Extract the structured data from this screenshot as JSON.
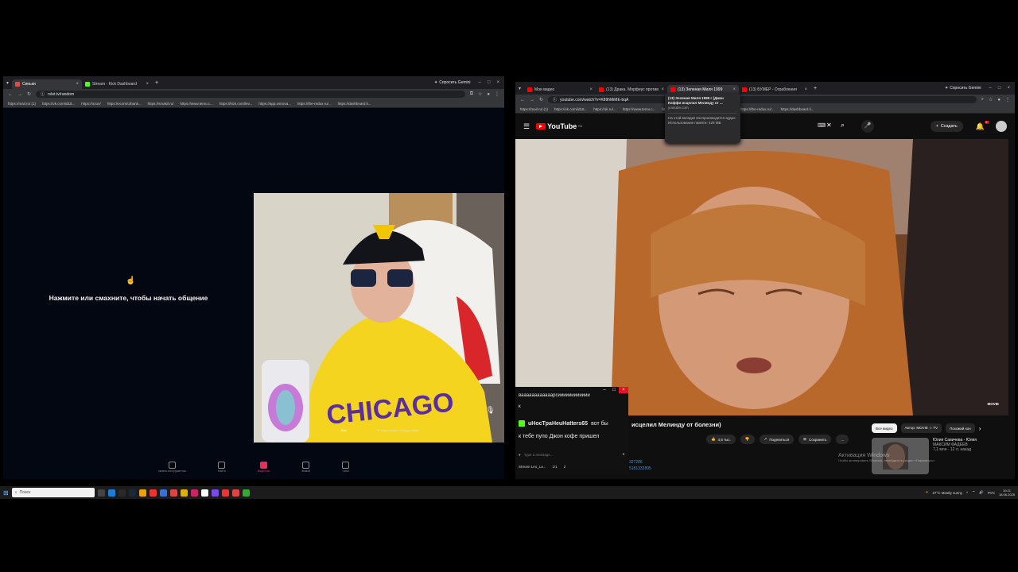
{
  "left_browser": {
    "tabs": [
      {
        "label": "Синьки",
        "color": "#e34b4b",
        "active": true
      },
      {
        "label": "Stream - Kick Dashboard",
        "color": "#53fc18",
        "active": false
      }
    ],
    "new_tab": "+",
    "gemini_label": "Спросить Gemini",
    "url": "rvlet.tv/random",
    "bookmarks": [
      "https://mail.ru/ (1)",
      "https://vk.com/id18...",
      "https://ozon/",
      "https://vcom/u/bank...",
      "https://smakil.ru/",
      "https://www.temu.c...",
      "https://kick.com/lev...",
      "https://app.osnova...",
      "https://the-redux.ru/...",
      "https://dashboard.li..."
    ]
  },
  "left_page": {
    "prompt": "Нажмите или смахните, чтобы начать общение",
    "cam_overlay": "Все",
    "cam_overlay_2": "Ж ведическое оборудование",
    "bottom_nav": [
      {
        "label": "панель инструментов",
        "active": false
      },
      {
        "label": "Найти",
        "active": false
      },
      {
        "label": "Видеочат",
        "active": true
      },
      {
        "label": "Живой",
        "active": false
      },
      {
        "label": "Чаты",
        "active": false
      }
    ]
  },
  "right_browser": {
    "tabs": [
      {
        "label": "Мои видео",
        "color": "#ff0000"
      },
      {
        "label": "(13) Драка. Морфеус против",
        "color": "#ff0000"
      },
      {
        "label": "(13) Зеленая Миля 1999",
        "color": "#ff0000"
      },
      {
        "label": "(13) БУМЕР - Ограбления",
        "color": "#ff0000"
      }
    ],
    "new_tab": "+",
    "gemini_label": "Спросить Gemini",
    "url": "youtube.com/watch?v=K89hMiME-bqA",
    "bookmarks": [
      "https://mail.ru/ (1)",
      "https://vk.com/id18...",
      "https://ok.ru/...",
      "https://www.temu.c...",
      "https://kick.com/leo...",
      "https://app.osnova...",
      "https://the-redux.ru/...",
      "https://dashboard.li..."
    ],
    "tooltip": {
      "title": "(13) Зеленая Миля 1999 г (Джон Коффи исцелил Мелинду от ...",
      "domain": "youtube.com",
      "line1": "На этой вкладке воспроизводится аудио",
      "line2": "Использование памяти: 429 МБ"
    }
  },
  "youtube": {
    "logo": "YouTube",
    "logo_sup": "RU",
    "create_label": "Создать",
    "notif_count": "9+",
    "video_title": "исцелил Мелинду от болезни)",
    "video_badge": "MOVIE",
    "likes": "4,5 тыс.",
    "share_label": "Поделиться",
    "save_label": "Сохранить",
    "more_label": "...",
    "chips": [
      "Все видео",
      "Автор: MOVIE ☆ TV",
      "Похожий кон"
    ],
    "reco": {
      "title": "Юлия Савичева - Юлия",
      "channel": "МАКСИМ ФАДЕЕВ",
      "meta": "7,1 млн · 12 л. назад"
    },
    "watermark": "Активация Windows",
    "watermark_sub": "Чтобы активировать Windows, перейдите в раздел «Параметры»."
  },
  "chat": {
    "line1": "ваааааааааааарсииииииииииии",
    "line2": "к",
    "user": "uHocTpaHeuHatters65",
    "msg1": "вот бы",
    "msg2": "к тебе пупо Джон кофе пришел",
    "input_placeholder": "Type a message...",
    "streamer": "Stream Leo_La...",
    "viewers": "1/1",
    "followers": "2",
    "id1": "327206",
    "id2": "5181332895"
  },
  "taskbar": {
    "search_placeholder": "Поиск",
    "weather": "27°C  Mostly sunny",
    "lang": "РУС",
    "time": "10:21",
    "date": "18.06.2025"
  },
  "colors": {
    "kick_green": "#53fc18",
    "yt_red": "#ff0000",
    "accent_pink": "#ec2c5a"
  }
}
